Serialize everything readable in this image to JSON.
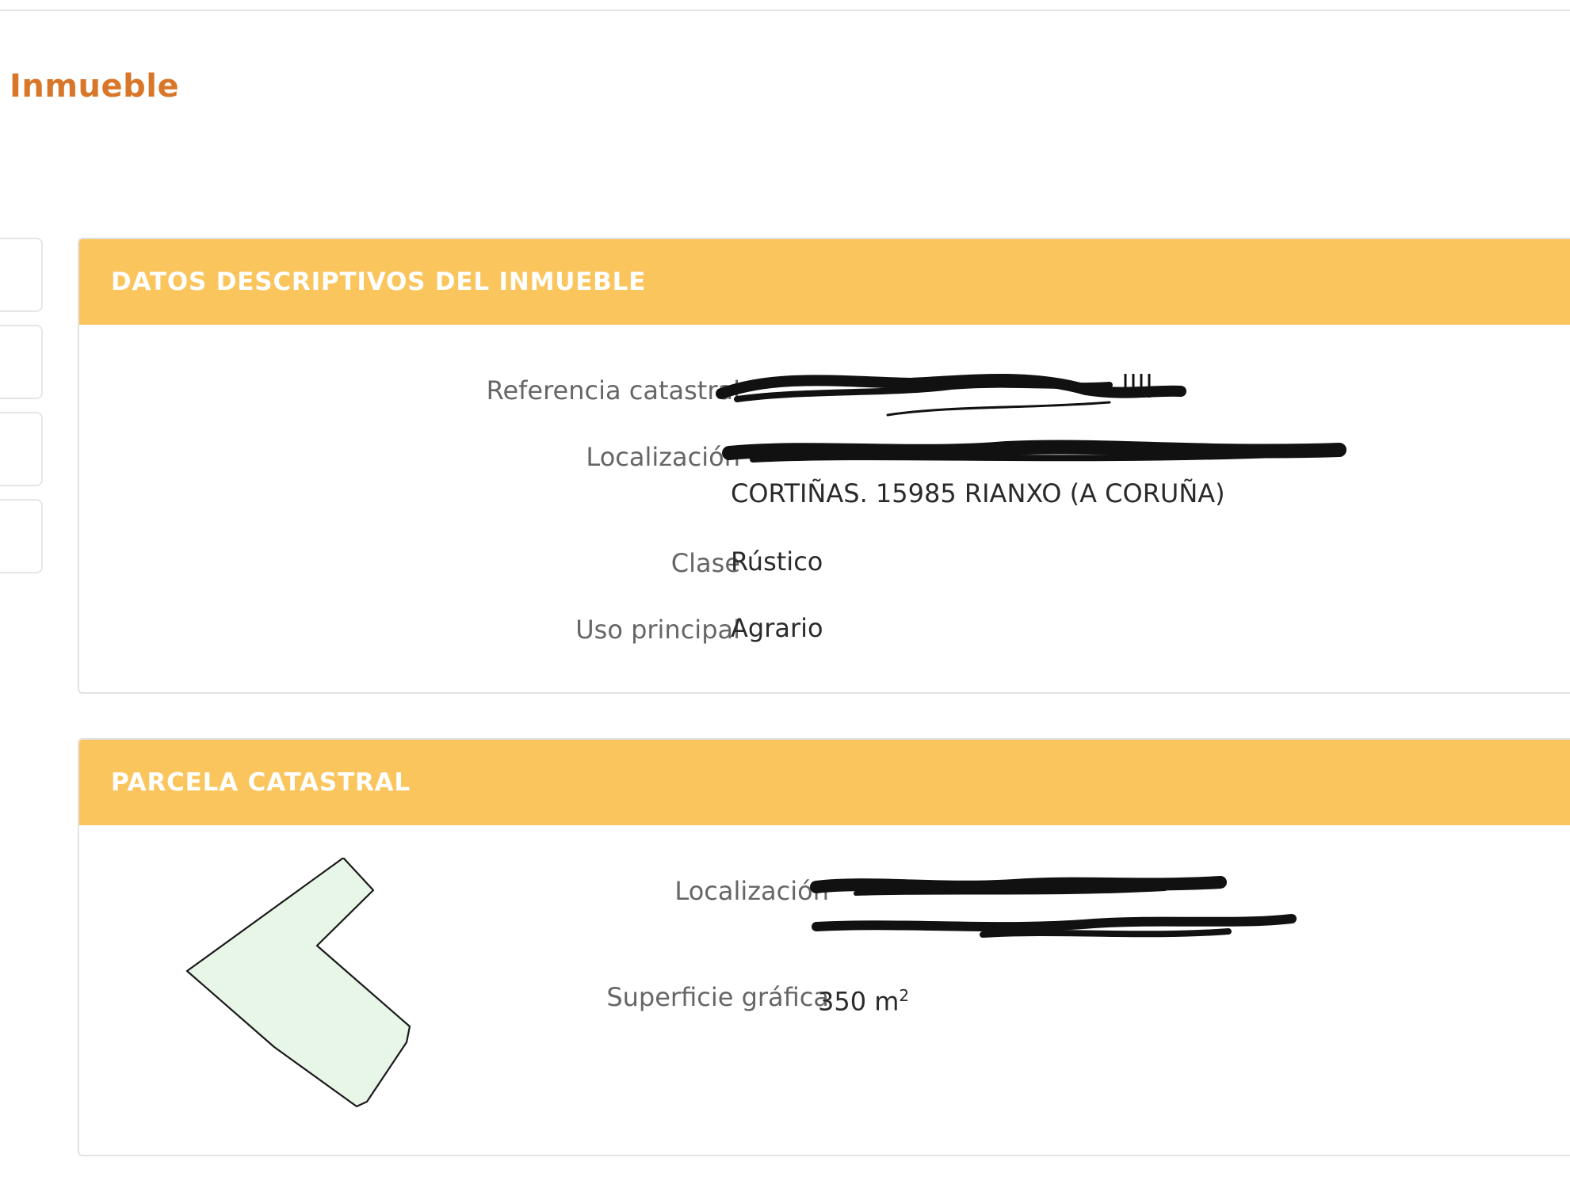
{
  "page": {
    "title": "Inmueble"
  },
  "sidebar": {
    "tabs": [
      {
        "label": ""
      },
      {
        "label": ""
      },
      {
        "label": ""
      },
      {
        "label": ""
      }
    ]
  },
  "descriptive_panel": {
    "header": "DATOS DESCRIPTIVOS DEL INMUEBLE",
    "fields": {
      "referencia_label": "Referencia catastral",
      "referencia_value": "",
      "localizacion_label": "Localización",
      "localizacion_line1": "",
      "localizacion_line2": "CORTIÑAS. 15985 RIANXO (A CORUÑA)",
      "clase_label": "Clase",
      "clase_value": "Rústico",
      "uso_label": "Uso principal",
      "uso_value": "Agrario"
    }
  },
  "parcel_panel": {
    "header": "PARCELA CATASTRAL",
    "fields": {
      "localizacion_label": "Localización",
      "localizacion_line1": "",
      "localizacion_line2": "",
      "superficie_label": "Superficie gráfica",
      "superficie_number": "350 m",
      "superficie_exponent": "2"
    },
    "plot_fill_color": "#e8f6e8",
    "plot_stroke_color": "#1a1a1a"
  },
  "colors": {
    "title": "#d8772a",
    "panel_header": "#fbc55e",
    "redaction": "#111111"
  }
}
